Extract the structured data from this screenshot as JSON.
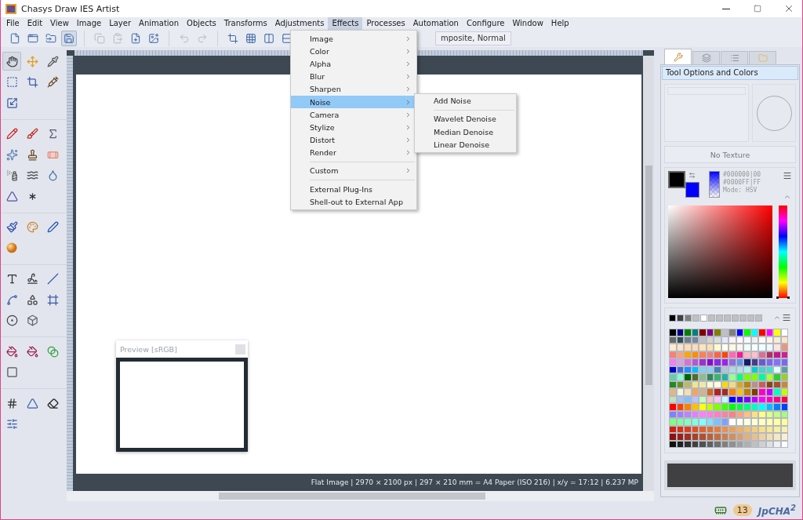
{
  "window": {
    "title": "Chasys Draw IES Artist"
  },
  "menu_bar": [
    {
      "label": "File",
      "selected": false
    },
    {
      "label": "Edit",
      "selected": false
    },
    {
      "label": "View",
      "selected": false
    },
    {
      "label": "Image",
      "selected": false
    },
    {
      "label": "Layer",
      "selected": false
    },
    {
      "label": "Animation",
      "selected": false
    },
    {
      "label": "Objects",
      "selected": false
    },
    {
      "label": "Transforms",
      "selected": false
    },
    {
      "label": "Adjustments",
      "selected": false
    },
    {
      "label": "Effects",
      "selected": true
    },
    {
      "label": "Processes",
      "selected": false
    },
    {
      "label": "Automation",
      "selected": false
    },
    {
      "label": "Configure",
      "selected": false
    },
    {
      "label": "Window",
      "selected": false
    },
    {
      "label": "Help",
      "selected": false
    }
  ],
  "toolbar": {
    "groups": [
      [
        {
          "kind": "new",
          "selected": false,
          "disabled": false
        },
        {
          "kind": "window",
          "selected": false,
          "disabled": false
        },
        {
          "kind": "open",
          "selected": false,
          "disabled": false
        },
        {
          "kind": "save",
          "selected": true,
          "disabled": false
        }
      ],
      [
        {
          "kind": "copy",
          "selected": false,
          "disabled": true
        },
        {
          "kind": "paste",
          "selected": false,
          "disabled": true
        },
        {
          "kind": "add-layer",
          "selected": false,
          "disabled": false
        },
        {
          "kind": "add-image",
          "selected": false,
          "disabled": false
        }
      ],
      [
        {
          "kind": "undo",
          "selected": false,
          "disabled": true
        },
        {
          "kind": "redo",
          "selected": false,
          "disabled": true
        }
      ],
      [
        {
          "kind": "crop",
          "selected": false,
          "disabled": false
        },
        {
          "kind": "grid",
          "selected": false,
          "disabled": false
        },
        {
          "kind": "columns",
          "selected": false,
          "disabled": false
        },
        {
          "kind": "rows",
          "selected": false,
          "disabled": false
        }
      ]
    ],
    "layer_mode": "mposite, Normal"
  },
  "effects_menu": {
    "groups": [
      [
        {
          "label": "Image",
          "submenu": true,
          "selected": false
        },
        {
          "label": "Color",
          "submenu": true,
          "selected": false
        },
        {
          "label": "Alpha",
          "submenu": true,
          "selected": false
        },
        {
          "label": "Blur",
          "submenu": true,
          "selected": false
        },
        {
          "label": "Sharpen",
          "submenu": true,
          "selected": false
        },
        {
          "label": "Noise",
          "submenu": true,
          "selected": true
        },
        {
          "label": "Camera",
          "submenu": true,
          "selected": false
        },
        {
          "label": "Stylize",
          "submenu": true,
          "selected": false
        },
        {
          "label": "Distort",
          "submenu": true,
          "selected": false
        },
        {
          "label": "Render",
          "submenu": true,
          "selected": false
        }
      ],
      [
        {
          "label": "Custom",
          "submenu": true,
          "selected": false
        }
      ],
      [
        {
          "label": "External Plug-Ins",
          "submenu": false,
          "selected": false
        },
        {
          "label": "Shell-out to External App",
          "submenu": false,
          "selected": false
        }
      ]
    ]
  },
  "noise_submenu": {
    "groups": [
      [
        "Add Noise"
      ],
      [
        "Wavelet Denoise",
        "Median Denoise",
        "Linear Denoise"
      ]
    ]
  },
  "toolbox": {
    "groups": [
      [
        {
          "kind": "hand",
          "selected": true
        },
        {
          "kind": "move",
          "selected": false
        },
        {
          "kind": "eyedropper",
          "selected": false
        },
        {
          "kind": "select",
          "selected": false
        },
        {
          "kind": "crop",
          "selected": false
        },
        {
          "kind": "syringe",
          "selected": false
        },
        {
          "kind": "scale",
          "selected": false
        }
      ],
      [
        {
          "kind": "pencil",
          "selected": false
        },
        {
          "kind": "brush",
          "selected": false
        },
        {
          "kind": "sigma",
          "selected": false
        },
        {
          "kind": "sparkles",
          "selected": false
        },
        {
          "kind": "stamp",
          "selected": false
        },
        {
          "kind": "bandage",
          "selected": false
        },
        {
          "kind": "spray",
          "selected": false
        },
        {
          "kind": "waves",
          "selected": false
        },
        {
          "kind": "drop",
          "selected": false
        },
        {
          "kind": "triangle",
          "selected": false
        },
        {
          "kind": "splat",
          "selected": false
        }
      ],
      [
        {
          "kind": "paintbrush",
          "selected": false
        },
        {
          "kind": "palette",
          "selected": false
        },
        {
          "kind": "pen",
          "selected": false
        },
        {
          "kind": "orb",
          "selected": false
        }
      ],
      [
        {
          "kind": "text",
          "selected": false
        },
        {
          "kind": "signature",
          "selected": false
        },
        {
          "kind": "line",
          "selected": false
        },
        {
          "kind": "curve",
          "selected": false
        },
        {
          "kind": "shapes",
          "selected": false
        },
        {
          "kind": "frame",
          "selected": false
        },
        {
          "kind": "ring",
          "selected": false
        },
        {
          "kind": "box",
          "selected": false
        }
      ],
      [
        {
          "kind": "bucket",
          "selected": false
        },
        {
          "kind": "bucket",
          "selected": false
        },
        {
          "kind": "gradient",
          "selected": false
        },
        {
          "kind": "shadow",
          "selected": false
        }
      ],
      [
        {
          "kind": "hash",
          "selected": false
        },
        {
          "kind": "perspective",
          "selected": false
        },
        {
          "kind": "eraser",
          "selected": false
        },
        {
          "kind": "sliders",
          "selected": false
        }
      ]
    ]
  },
  "canvas": {
    "status": "Flat Image | 2970 × 2100 px | 297 × 210 mm = A4 Paper (ISO 216) | x/y = 17:12 | 6.237 MP"
  },
  "preview": {
    "title": "Preview [sRGB]"
  },
  "right_panel": {
    "tabs": [
      {
        "kind": "tools",
        "selected": true
      },
      {
        "kind": "layers",
        "selected": false
      },
      {
        "kind": "list",
        "selected": false
      },
      {
        "kind": "folder",
        "selected": false
      }
    ],
    "title": "Tool Options and Colors",
    "texture": "No Texture",
    "swatches": [
      {
        "color": "#000000"
      },
      {
        "color": "#0000ff"
      }
    ],
    "primary_hex": "#000000|00",
    "secondary_hex": "#0000FF|FF",
    "mode": "Mode: HSV",
    "hue_slider": {
      "level": 0
    },
    "recent_colors": [
      {
        "color": "#000000"
      },
      {
        "color": "#404040"
      },
      {
        "color": "#808080"
      },
      {
        "color": "#c0c0c0"
      },
      {
        "color": "#ffffff"
      },
      {
        "color": "#c0c0c0"
      },
      {
        "color": "#c0c0c0"
      },
      {
        "color": "#c0c0c0"
      },
      {
        "color": "#c0c0c0"
      },
      {
        "color": "#c0c0c0"
      },
      {
        "color": "#c0c0c0"
      },
      {
        "color": "#c0c0c0"
      }
    ],
    "palette": [
      {
        "color": "#000000"
      },
      {
        "color": "#000080"
      },
      {
        "color": "#008000"
      },
      {
        "color": "#008080"
      },
      {
        "color": "#800000"
      },
      {
        "color": "#800080"
      },
      {
        "color": "#808000"
      },
      {
        "color": "#c0c0c0"
      },
      {
        "color": "#808080"
      },
      {
        "color": "#0000ff"
      },
      {
        "color": "#00ff00"
      },
      {
        "color": "#00ffff"
      },
      {
        "color": "#ff0000"
      },
      {
        "color": "#ff00ff"
      },
      {
        "color": "#ffff00"
      },
      {
        "color": "#ffffff"
      },
      {
        "color": "#696969"
      },
      {
        "color": "#2f4f4f"
      },
      {
        "color": "#708090"
      },
      {
        "color": "#778899"
      },
      {
        "color": "#c0c0c0"
      },
      {
        "color": "#d3d3d3"
      },
      {
        "color": "#dcdcdc"
      },
      {
        "color": "#e6e6fa"
      },
      {
        "color": "#fff0f5"
      },
      {
        "color": "#fffafa"
      },
      {
        "color": "#f8f8ff"
      },
      {
        "color": "#eeeeee"
      },
      {
        "color": "#fffaf0"
      },
      {
        "color": "#fdf5e6"
      },
      {
        "color": "#faebd7"
      },
      {
        "color": "#ffe4c4"
      },
      {
        "color": "#ffebcd"
      },
      {
        "color": "#ffe4c4"
      },
      {
        "color": "#ffdead"
      },
      {
        "color": "#ffdab9"
      },
      {
        "color": "#ffe4b5"
      },
      {
        "color": "#ffdead"
      },
      {
        "color": "#fffacd"
      },
      {
        "color": "#fffff0"
      },
      {
        "color": "#fff8dc"
      },
      {
        "color": "#fff5ee"
      },
      {
        "color": "#f0fff0"
      },
      {
        "color": "#f5fffa"
      },
      {
        "color": "#f0ffff"
      },
      {
        "color": "#f0f8ff"
      },
      {
        "color": "#ffe4e1"
      },
      {
        "color": "#e9967a"
      },
      {
        "color": "#fa8072"
      },
      {
        "color": "#ffa07a"
      },
      {
        "color": "#ffa500"
      },
      {
        "color": "#ff8c00"
      },
      {
        "color": "#ff7f50"
      },
      {
        "color": "#f08080"
      },
      {
        "color": "#ff6347"
      },
      {
        "color": "#ff4500"
      },
      {
        "color": "#ff69b4"
      },
      {
        "color": "#ff1493"
      },
      {
        "color": "#ffb6c1"
      },
      {
        "color": "#ffc0cb"
      },
      {
        "color": "#db7093"
      },
      {
        "color": "#b03060"
      },
      {
        "color": "#c71585"
      },
      {
        "color": "#d02090"
      },
      {
        "color": "#ee82ee"
      },
      {
        "color": "#dda0dd"
      },
      {
        "color": "#da70d6"
      },
      {
        "color": "#ba55d3"
      },
      {
        "color": "#9932cc"
      },
      {
        "color": "#9400d3"
      },
      {
        "color": "#8a2be2"
      },
      {
        "color": "#a020f0"
      },
      {
        "color": "#9370db"
      },
      {
        "color": "#6495ed"
      },
      {
        "color": "#191970"
      },
      {
        "color": "#483d8b"
      },
      {
        "color": "#6a5acd"
      },
      {
        "color": "#7b68ee"
      },
      {
        "color": "#8470ff"
      },
      {
        "color": "#7b68ee"
      },
      {
        "color": "#0000cd"
      },
      {
        "color": "#4169e1"
      },
      {
        "color": "#1e90ff"
      },
      {
        "color": "#00bfff"
      },
      {
        "color": "#87ceeb"
      },
      {
        "color": "#87cefa"
      },
      {
        "color": "#4682b4"
      },
      {
        "color": "#b0c4de"
      },
      {
        "color": "#add8e6"
      },
      {
        "color": "#b0e0e6"
      },
      {
        "color": "#afeeee"
      },
      {
        "color": "#00ced1"
      },
      {
        "color": "#48d1cc"
      },
      {
        "color": "#40e0d0"
      },
      {
        "color": "#e0ffff"
      },
      {
        "color": "#5f9ea0"
      },
      {
        "color": "#66cdaa"
      },
      {
        "color": "#7fffd4"
      },
      {
        "color": "#006400"
      },
      {
        "color": "#556b2f"
      },
      {
        "color": "#8fbc8f"
      },
      {
        "color": "#2e8b57"
      },
      {
        "color": "#3cb371"
      },
      {
        "color": "#20b2aa"
      },
      {
        "color": "#98fb98"
      },
      {
        "color": "#00ff7f"
      },
      {
        "color": "#7cfc00"
      },
      {
        "color": "#7fff00"
      },
      {
        "color": "#00fa9a"
      },
      {
        "color": "#adff2f"
      },
      {
        "color": "#32cd32"
      },
      {
        "color": "#9acd32"
      },
      {
        "color": "#228b22"
      },
      {
        "color": "#6b8e23"
      },
      {
        "color": "#bdb76b"
      },
      {
        "color": "#f0e68c"
      },
      {
        "color": "#eee8aa"
      },
      {
        "color": "#fafad2"
      },
      {
        "color": "#ffffe0"
      },
      {
        "color": "#ffd700"
      },
      {
        "color": "#eedd82"
      },
      {
        "color": "#daa520"
      },
      {
        "color": "#b8860b"
      },
      {
        "color": "#bc8f8f"
      },
      {
        "color": "#cd5c5c"
      },
      {
        "color": "#8b4513"
      },
      {
        "color": "#a0522d"
      },
      {
        "color": "#cd853f"
      },
      {
        "color": "#deb887"
      },
      {
        "color": "#f5f5dc"
      },
      {
        "color": "#f5deb3"
      },
      {
        "color": "#f4a460"
      },
      {
        "color": "#d2b48c"
      },
      {
        "color": "#d2691e"
      },
      {
        "color": "#b22222"
      },
      {
        "color": "#a52a2a"
      },
      {
        "color": "#ff8000"
      },
      {
        "color": "#ffc000"
      },
      {
        "color": "#c08000"
      },
      {
        "color": "#804000"
      },
      {
        "color": "#ff00c0"
      },
      {
        "color": "#c000ff"
      },
      {
        "color": "#00ffc0"
      },
      {
        "color": "#c0ff00"
      },
      {
        "color": "#c0e0c0"
      },
      {
        "color": "#a0c0ff"
      },
      {
        "color": "#80c0ff"
      },
      {
        "color": "#c0c0ff"
      },
      {
        "color": "#c0ffc0"
      },
      {
        "color": "#ffc0c0"
      },
      {
        "color": "#ffc0ff"
      },
      {
        "color": "#c0ffff"
      },
      {
        "color": "#0000ff"
      },
      {
        "color": "#4000ff"
      },
      {
        "color": "#8000ff"
      },
      {
        "color": "#c000ff"
      },
      {
        "color": "#ff00ff"
      },
      {
        "color": "#ff00c0"
      },
      {
        "color": "#ff0080"
      },
      {
        "color": "#ff0040"
      },
      {
        "color": "#ff0000"
      },
      {
        "color": "#ff4000"
      },
      {
        "color": "#ff8000"
      },
      {
        "color": "#ffc000"
      },
      {
        "color": "#ffff00"
      },
      {
        "color": "#c0ff00"
      },
      {
        "color": "#80ff00"
      },
      {
        "color": "#40ff00"
      },
      {
        "color": "#00ff00"
      },
      {
        "color": "#00ff40"
      },
      {
        "color": "#00ff80"
      },
      {
        "color": "#00ffc0"
      },
      {
        "color": "#00ffff"
      },
      {
        "color": "#00c0ff"
      },
      {
        "color": "#0080ff"
      },
      {
        "color": "#0040ff"
      },
      {
        "color": "#8080ff"
      },
      {
        "color": "#a080ff"
      },
      {
        "color": "#c080ff"
      },
      {
        "color": "#e080ff"
      },
      {
        "color": "#ff80ff"
      },
      {
        "color": "#ff80e0"
      },
      {
        "color": "#ff80c0"
      },
      {
        "color": "#ff80a0"
      },
      {
        "color": "#ff8080"
      },
      {
        "color": "#ffa080"
      },
      {
        "color": "#ffc080"
      },
      {
        "color": "#ffe080"
      },
      {
        "color": "#ffff80"
      },
      {
        "color": "#e0ff80"
      },
      {
        "color": "#c0ff80"
      },
      {
        "color": "#a0ff80"
      },
      {
        "color": "#80ff80"
      },
      {
        "color": "#80ffa0"
      },
      {
        "color": "#80ffc0"
      },
      {
        "color": "#80ffe0"
      },
      {
        "color": "#80ffff"
      },
      {
        "color": "#80e0ff"
      },
      {
        "color": "#80c0ff"
      },
      {
        "color": "#80a0ff"
      },
      {
        "color": "#ffffff"
      },
      {
        "color": "#fffff0"
      },
      {
        "color": "#ffffe0"
      },
      {
        "color": "#ffffd0"
      },
      {
        "color": "#ffffc0"
      },
      {
        "color": "#ffffb0"
      },
      {
        "color": "#ffffa0"
      },
      {
        "color": "#ffff90"
      },
      {
        "color": "#d02010"
      },
      {
        "color": "#d83010"
      },
      {
        "color": "#d84020"
      },
      {
        "color": "#e05020"
      },
      {
        "color": "#e06030"
      },
      {
        "color": "#e07030"
      },
      {
        "color": "#e08040"
      },
      {
        "color": "#e89050"
      },
      {
        "color": "#e8a060"
      },
      {
        "color": "#f0b060"
      },
      {
        "color": "#f0c070"
      },
      {
        "color": "#f0d080"
      },
      {
        "color": "#f8e080"
      },
      {
        "color": "#f8e890"
      },
      {
        "color": "#f8f0a0"
      },
      {
        "color": "#f8f0b0"
      },
      {
        "color": "#901010"
      },
      {
        "color": "#982018"
      },
      {
        "color": "#a03020"
      },
      {
        "color": "#a84028"
      },
      {
        "color": "#b05030"
      },
      {
        "color": "#b86038"
      },
      {
        "color": "#c07040"
      },
      {
        "color": "#c88050"
      },
      {
        "color": "#d09060"
      },
      {
        "color": "#d8a070"
      },
      {
        "color": "#e0b080"
      },
      {
        "color": "#e8c090"
      },
      {
        "color": "#f0d0a0"
      },
      {
        "color": "#f0e0b0"
      },
      {
        "color": "#f8e8c0"
      },
      {
        "color": "#f8f0d0"
      },
      {
        "color": "#101010"
      },
      {
        "color": "#202020"
      },
      {
        "color": "#303030"
      },
      {
        "color": "#404040"
      },
      {
        "color": "#505050"
      },
      {
        "color": "#606060"
      },
      {
        "color": "#707070"
      },
      {
        "color": "#808080"
      },
      {
        "color": "#909090"
      },
      {
        "color": "#a0a0a0"
      },
      {
        "color": "#b0b0b0"
      },
      {
        "color": "#c0c0c0"
      },
      {
        "color": "#d0d0d0"
      },
      {
        "color": "#e0e0e0"
      },
      {
        "color": "#f0f0f0"
      },
      {
        "color": "#ffffff"
      }
    ]
  },
  "status_bar": {
    "badge": "13",
    "logo": "JpCHA$^{2}$"
  }
}
